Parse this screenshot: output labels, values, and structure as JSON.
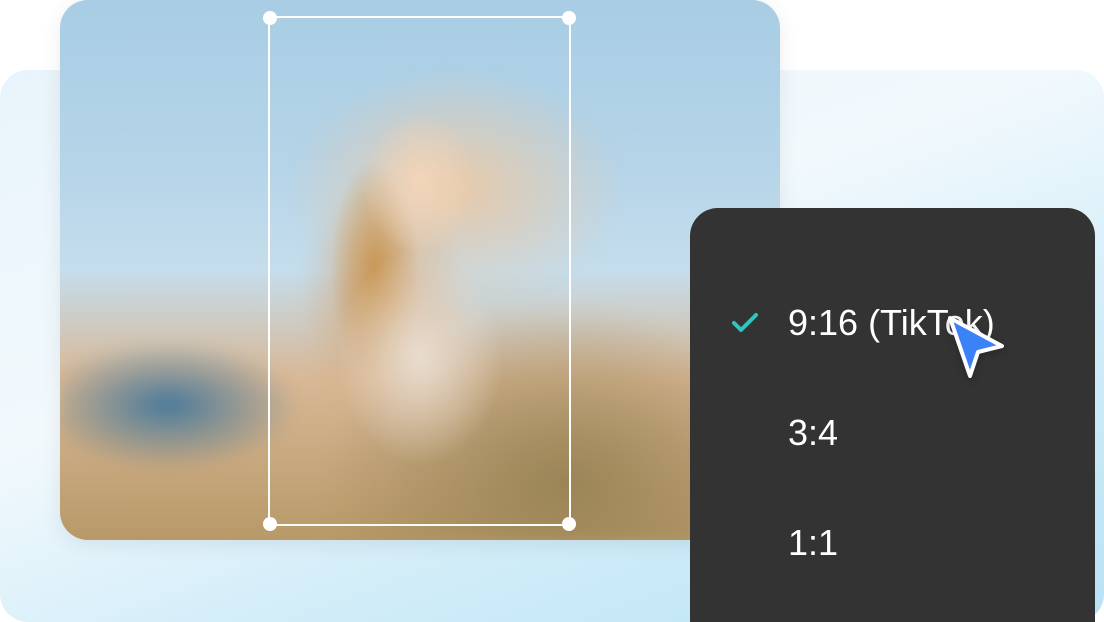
{
  "ratio_options": [
    {
      "label": "9:16 (TikTok)",
      "selected": true
    },
    {
      "label": "3:4",
      "selected": false
    },
    {
      "label": "1:1",
      "selected": false
    }
  ],
  "colors": {
    "panel_bg": "#333333",
    "check": "#2ec7c0",
    "cursor": "#3b82f6"
  }
}
